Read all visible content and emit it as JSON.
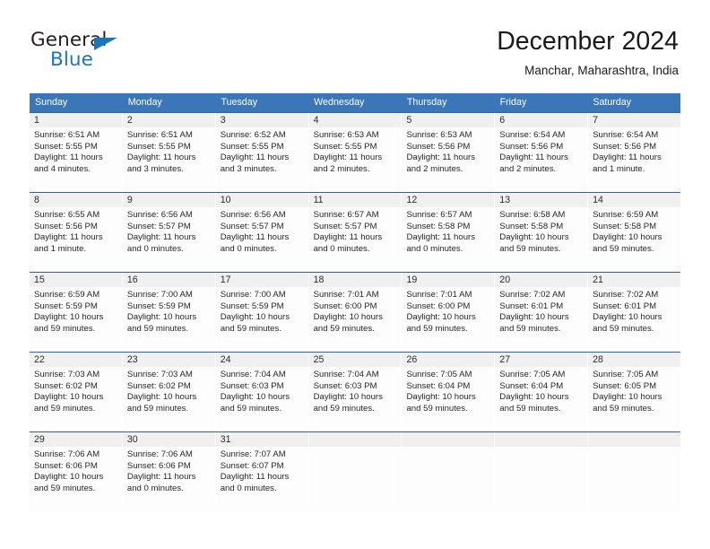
{
  "brand": {
    "name_part1": "General",
    "name_part2": "Blue",
    "flag_icon": "triangle-flag-icon"
  },
  "header": {
    "title": "December 2024",
    "subtitle": "Manchar, Maharashtra, India"
  },
  "colors": {
    "header_blue": "#3a76b8",
    "divider_blue": "#2a63a8",
    "day_number_band": "#f0f0f0",
    "brand_blue": "#1b75bb",
    "text": "#262626"
  },
  "weekday_headers": [
    "Sunday",
    "Monday",
    "Tuesday",
    "Wednesday",
    "Thursday",
    "Friday",
    "Saturday"
  ],
  "weeks": [
    [
      {
        "day": "1",
        "sunrise": "Sunrise: 6:51 AM",
        "sunset": "Sunset: 5:55 PM",
        "daylight1": "Daylight: 11 hours",
        "daylight2": "and 4 minutes."
      },
      {
        "day": "2",
        "sunrise": "Sunrise: 6:51 AM",
        "sunset": "Sunset: 5:55 PM",
        "daylight1": "Daylight: 11 hours",
        "daylight2": "and 3 minutes."
      },
      {
        "day": "3",
        "sunrise": "Sunrise: 6:52 AM",
        "sunset": "Sunset: 5:55 PM",
        "daylight1": "Daylight: 11 hours",
        "daylight2": "and 3 minutes."
      },
      {
        "day": "4",
        "sunrise": "Sunrise: 6:53 AM",
        "sunset": "Sunset: 5:55 PM",
        "daylight1": "Daylight: 11 hours",
        "daylight2": "and 2 minutes."
      },
      {
        "day": "5",
        "sunrise": "Sunrise: 6:53 AM",
        "sunset": "Sunset: 5:56 PM",
        "daylight1": "Daylight: 11 hours",
        "daylight2": "and 2 minutes."
      },
      {
        "day": "6",
        "sunrise": "Sunrise: 6:54 AM",
        "sunset": "Sunset: 5:56 PM",
        "daylight1": "Daylight: 11 hours",
        "daylight2": "and 2 minutes."
      },
      {
        "day": "7",
        "sunrise": "Sunrise: 6:54 AM",
        "sunset": "Sunset: 5:56 PM",
        "daylight1": "Daylight: 11 hours",
        "daylight2": "and 1 minute."
      }
    ],
    [
      {
        "day": "8",
        "sunrise": "Sunrise: 6:55 AM",
        "sunset": "Sunset: 5:56 PM",
        "daylight1": "Daylight: 11 hours",
        "daylight2": "and 1 minute."
      },
      {
        "day": "9",
        "sunrise": "Sunrise: 6:56 AM",
        "sunset": "Sunset: 5:57 PM",
        "daylight1": "Daylight: 11 hours",
        "daylight2": "and 0 minutes."
      },
      {
        "day": "10",
        "sunrise": "Sunrise: 6:56 AM",
        "sunset": "Sunset: 5:57 PM",
        "daylight1": "Daylight: 11 hours",
        "daylight2": "and 0 minutes."
      },
      {
        "day": "11",
        "sunrise": "Sunrise: 6:57 AM",
        "sunset": "Sunset: 5:57 PM",
        "daylight1": "Daylight: 11 hours",
        "daylight2": "and 0 minutes."
      },
      {
        "day": "12",
        "sunrise": "Sunrise: 6:57 AM",
        "sunset": "Sunset: 5:58 PM",
        "daylight1": "Daylight: 11 hours",
        "daylight2": "and 0 minutes."
      },
      {
        "day": "13",
        "sunrise": "Sunrise: 6:58 AM",
        "sunset": "Sunset: 5:58 PM",
        "daylight1": "Daylight: 10 hours",
        "daylight2": "and 59 minutes."
      },
      {
        "day": "14",
        "sunrise": "Sunrise: 6:59 AM",
        "sunset": "Sunset: 5:58 PM",
        "daylight1": "Daylight: 10 hours",
        "daylight2": "and 59 minutes."
      }
    ],
    [
      {
        "day": "15",
        "sunrise": "Sunrise: 6:59 AM",
        "sunset": "Sunset: 5:59 PM",
        "daylight1": "Daylight: 10 hours",
        "daylight2": "and 59 minutes."
      },
      {
        "day": "16",
        "sunrise": "Sunrise: 7:00 AM",
        "sunset": "Sunset: 5:59 PM",
        "daylight1": "Daylight: 10 hours",
        "daylight2": "and 59 minutes."
      },
      {
        "day": "17",
        "sunrise": "Sunrise: 7:00 AM",
        "sunset": "Sunset: 5:59 PM",
        "daylight1": "Daylight: 10 hours",
        "daylight2": "and 59 minutes."
      },
      {
        "day": "18",
        "sunrise": "Sunrise: 7:01 AM",
        "sunset": "Sunset: 6:00 PM",
        "daylight1": "Daylight: 10 hours",
        "daylight2": "and 59 minutes."
      },
      {
        "day": "19",
        "sunrise": "Sunrise: 7:01 AM",
        "sunset": "Sunset: 6:00 PM",
        "daylight1": "Daylight: 10 hours",
        "daylight2": "and 59 minutes."
      },
      {
        "day": "20",
        "sunrise": "Sunrise: 7:02 AM",
        "sunset": "Sunset: 6:01 PM",
        "daylight1": "Daylight: 10 hours",
        "daylight2": "and 59 minutes."
      },
      {
        "day": "21",
        "sunrise": "Sunrise: 7:02 AM",
        "sunset": "Sunset: 6:01 PM",
        "daylight1": "Daylight: 10 hours",
        "daylight2": "and 59 minutes."
      }
    ],
    [
      {
        "day": "22",
        "sunrise": "Sunrise: 7:03 AM",
        "sunset": "Sunset: 6:02 PM",
        "daylight1": "Daylight: 10 hours",
        "daylight2": "and 59 minutes."
      },
      {
        "day": "23",
        "sunrise": "Sunrise: 7:03 AM",
        "sunset": "Sunset: 6:02 PM",
        "daylight1": "Daylight: 10 hours",
        "daylight2": "and 59 minutes."
      },
      {
        "day": "24",
        "sunrise": "Sunrise: 7:04 AM",
        "sunset": "Sunset: 6:03 PM",
        "daylight1": "Daylight: 10 hours",
        "daylight2": "and 59 minutes."
      },
      {
        "day": "25",
        "sunrise": "Sunrise: 7:04 AM",
        "sunset": "Sunset: 6:03 PM",
        "daylight1": "Daylight: 10 hours",
        "daylight2": "and 59 minutes."
      },
      {
        "day": "26",
        "sunrise": "Sunrise: 7:05 AM",
        "sunset": "Sunset: 6:04 PM",
        "daylight1": "Daylight: 10 hours",
        "daylight2": "and 59 minutes."
      },
      {
        "day": "27",
        "sunrise": "Sunrise: 7:05 AM",
        "sunset": "Sunset: 6:04 PM",
        "daylight1": "Daylight: 10 hours",
        "daylight2": "and 59 minutes."
      },
      {
        "day": "28",
        "sunrise": "Sunrise: 7:05 AM",
        "sunset": "Sunset: 6:05 PM",
        "daylight1": "Daylight: 10 hours",
        "daylight2": "and 59 minutes."
      }
    ],
    [
      {
        "day": "29",
        "sunrise": "Sunrise: 7:06 AM",
        "sunset": "Sunset: 6:06 PM",
        "daylight1": "Daylight: 10 hours",
        "daylight2": "and 59 minutes."
      },
      {
        "day": "30",
        "sunrise": "Sunrise: 7:06 AM",
        "sunset": "Sunset: 6:06 PM",
        "daylight1": "Daylight: 11 hours",
        "daylight2": "and 0 minutes."
      },
      {
        "day": "31",
        "sunrise": "Sunrise: 7:07 AM",
        "sunset": "Sunset: 6:07 PM",
        "daylight1": "Daylight: 11 hours",
        "daylight2": "and 0 minutes."
      },
      {
        "day": "",
        "sunrise": "",
        "sunset": "",
        "daylight1": "",
        "daylight2": ""
      },
      {
        "day": "",
        "sunrise": "",
        "sunset": "",
        "daylight1": "",
        "daylight2": ""
      },
      {
        "day": "",
        "sunrise": "",
        "sunset": "",
        "daylight1": "",
        "daylight2": ""
      },
      {
        "day": "",
        "sunrise": "",
        "sunset": "",
        "daylight1": "",
        "daylight2": ""
      }
    ]
  ]
}
